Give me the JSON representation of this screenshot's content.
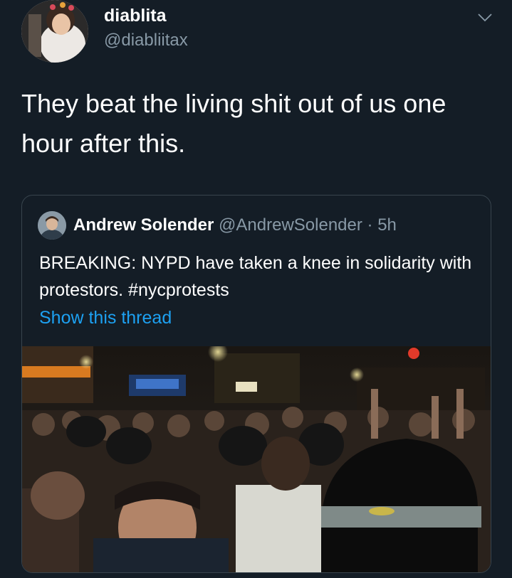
{
  "tweet": {
    "display_name": "diablita",
    "handle": "@diabliitax",
    "text": "They beat the living shit out of us one hour after this."
  },
  "quoted_tweet": {
    "display_name": "Andrew Solender",
    "handle": "@AndrewSolender",
    "separator": " · ",
    "time": "5h",
    "text": "BREAKING: NYPD have taken a knee in solidarity with protestors. #nycprotests",
    "thread_link": "Show this thread"
  },
  "icons": {
    "chevron": "chevron-down-icon"
  },
  "colors": {
    "background": "#141d26",
    "secondary_text": "#8899a6",
    "link": "#1da1f2",
    "border": "#38444d"
  }
}
